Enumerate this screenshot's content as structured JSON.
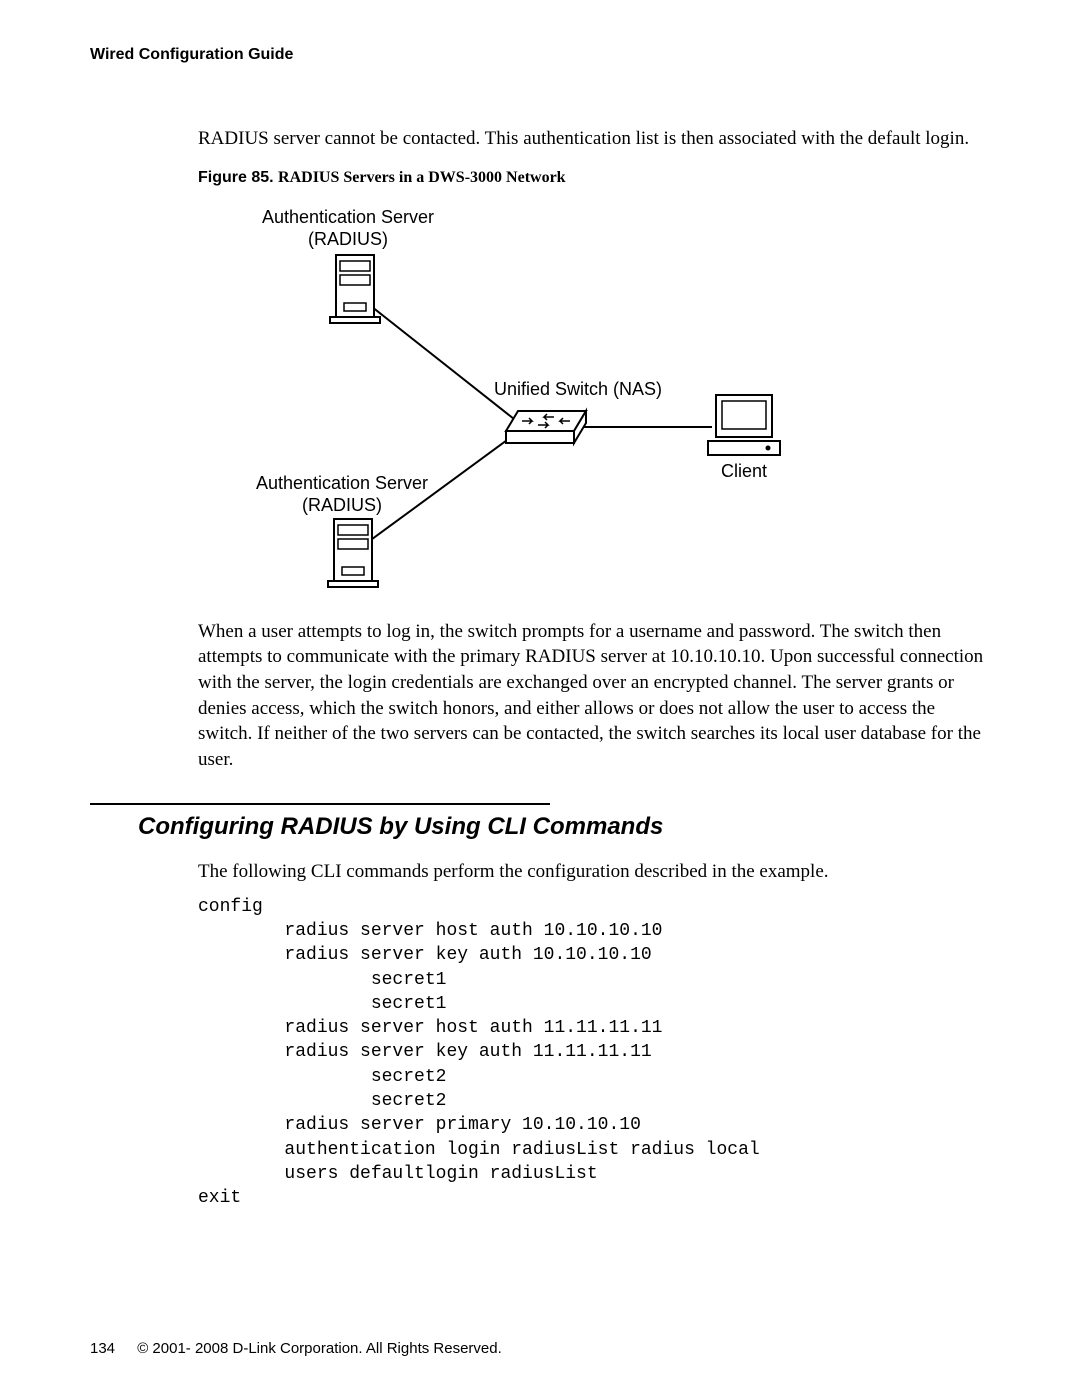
{
  "header": {
    "running_head": "Wired Configuration Guide"
  },
  "para": {
    "intro": "RADIUS server cannot be contacted. This authentication list is then associated with the default login.",
    "after_fig": "When a user attempts to log in, the switch prompts for a username and password. The switch then attempts to communicate with the primary RADIUS server at 10.10.10.10. Upon successful connection with the server, the login credentials are exchanged over an encrypted channel. The server grants or denies access, which the switch honors, and either allows or does not allow the user to access the switch. If neither of the two servers can be contacted, the switch searches its local user database for the user.",
    "cli_intro": "The following CLI commands perform the configuration described in the example."
  },
  "figure": {
    "lead": "Figure 85. ",
    "title": "RADIUS Servers in a DWS-3000 Network",
    "top_label_l1": "Authentication Server",
    "top_label_l2": "(RADIUS)",
    "mid_label": "Unified Switch (NAS)",
    "client_label": "Client",
    "bottom_label_l1": "Authentication Server",
    "bottom_label_l2": "(RADIUS)"
  },
  "section": {
    "title": "Configuring RADIUS by Using CLI Commands"
  },
  "cli": {
    "text": "config\n        radius server host auth 10.10.10.10\n        radius server key auth 10.10.10.10\n                secret1\n                secret1\n        radius server host auth 11.11.11.11\n        radius server key auth 11.11.11.11\n                secret2\n                secret2\n        radius server primary 10.10.10.10\n        authentication login radiusList radius local\n        users defaultlogin radiusList\nexit"
  },
  "footer": {
    "page_number": "134",
    "copyright": "© 2001- 2008 D-Link Corporation. All Rights Reserved."
  }
}
